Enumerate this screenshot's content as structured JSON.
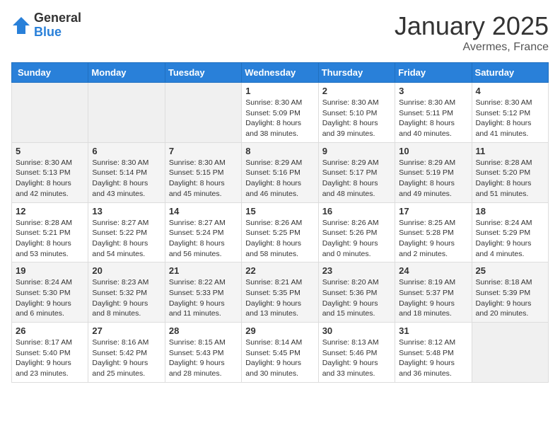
{
  "header": {
    "logo_general": "General",
    "logo_blue": "Blue",
    "month_title": "January 2025",
    "location": "Avermes, France"
  },
  "weekdays": [
    "Sunday",
    "Monday",
    "Tuesday",
    "Wednesday",
    "Thursday",
    "Friday",
    "Saturday"
  ],
  "weeks": [
    [
      {
        "day": "",
        "info": ""
      },
      {
        "day": "",
        "info": ""
      },
      {
        "day": "",
        "info": ""
      },
      {
        "day": "1",
        "info": "Sunrise: 8:30 AM\nSunset: 5:09 PM\nDaylight: 8 hours\nand 38 minutes."
      },
      {
        "day": "2",
        "info": "Sunrise: 8:30 AM\nSunset: 5:10 PM\nDaylight: 8 hours\nand 39 minutes."
      },
      {
        "day": "3",
        "info": "Sunrise: 8:30 AM\nSunset: 5:11 PM\nDaylight: 8 hours\nand 40 minutes."
      },
      {
        "day": "4",
        "info": "Sunrise: 8:30 AM\nSunset: 5:12 PM\nDaylight: 8 hours\nand 41 minutes."
      }
    ],
    [
      {
        "day": "5",
        "info": "Sunrise: 8:30 AM\nSunset: 5:13 PM\nDaylight: 8 hours\nand 42 minutes."
      },
      {
        "day": "6",
        "info": "Sunrise: 8:30 AM\nSunset: 5:14 PM\nDaylight: 8 hours\nand 43 minutes."
      },
      {
        "day": "7",
        "info": "Sunrise: 8:30 AM\nSunset: 5:15 PM\nDaylight: 8 hours\nand 45 minutes."
      },
      {
        "day": "8",
        "info": "Sunrise: 8:29 AM\nSunset: 5:16 PM\nDaylight: 8 hours\nand 46 minutes."
      },
      {
        "day": "9",
        "info": "Sunrise: 8:29 AM\nSunset: 5:17 PM\nDaylight: 8 hours\nand 48 minutes."
      },
      {
        "day": "10",
        "info": "Sunrise: 8:29 AM\nSunset: 5:19 PM\nDaylight: 8 hours\nand 49 minutes."
      },
      {
        "day": "11",
        "info": "Sunrise: 8:28 AM\nSunset: 5:20 PM\nDaylight: 8 hours\nand 51 minutes."
      }
    ],
    [
      {
        "day": "12",
        "info": "Sunrise: 8:28 AM\nSunset: 5:21 PM\nDaylight: 8 hours\nand 53 minutes."
      },
      {
        "day": "13",
        "info": "Sunrise: 8:27 AM\nSunset: 5:22 PM\nDaylight: 8 hours\nand 54 minutes."
      },
      {
        "day": "14",
        "info": "Sunrise: 8:27 AM\nSunset: 5:24 PM\nDaylight: 8 hours\nand 56 minutes."
      },
      {
        "day": "15",
        "info": "Sunrise: 8:26 AM\nSunset: 5:25 PM\nDaylight: 8 hours\nand 58 minutes."
      },
      {
        "day": "16",
        "info": "Sunrise: 8:26 AM\nSunset: 5:26 PM\nDaylight: 9 hours\nand 0 minutes."
      },
      {
        "day": "17",
        "info": "Sunrise: 8:25 AM\nSunset: 5:28 PM\nDaylight: 9 hours\nand 2 minutes."
      },
      {
        "day": "18",
        "info": "Sunrise: 8:24 AM\nSunset: 5:29 PM\nDaylight: 9 hours\nand 4 minutes."
      }
    ],
    [
      {
        "day": "19",
        "info": "Sunrise: 8:24 AM\nSunset: 5:30 PM\nDaylight: 9 hours\nand 6 minutes."
      },
      {
        "day": "20",
        "info": "Sunrise: 8:23 AM\nSunset: 5:32 PM\nDaylight: 9 hours\nand 8 minutes."
      },
      {
        "day": "21",
        "info": "Sunrise: 8:22 AM\nSunset: 5:33 PM\nDaylight: 9 hours\nand 11 minutes."
      },
      {
        "day": "22",
        "info": "Sunrise: 8:21 AM\nSunset: 5:35 PM\nDaylight: 9 hours\nand 13 minutes."
      },
      {
        "day": "23",
        "info": "Sunrise: 8:20 AM\nSunset: 5:36 PM\nDaylight: 9 hours\nand 15 minutes."
      },
      {
        "day": "24",
        "info": "Sunrise: 8:19 AM\nSunset: 5:37 PM\nDaylight: 9 hours\nand 18 minutes."
      },
      {
        "day": "25",
        "info": "Sunrise: 8:18 AM\nSunset: 5:39 PM\nDaylight: 9 hours\nand 20 minutes."
      }
    ],
    [
      {
        "day": "26",
        "info": "Sunrise: 8:17 AM\nSunset: 5:40 PM\nDaylight: 9 hours\nand 23 minutes."
      },
      {
        "day": "27",
        "info": "Sunrise: 8:16 AM\nSunset: 5:42 PM\nDaylight: 9 hours\nand 25 minutes."
      },
      {
        "day": "28",
        "info": "Sunrise: 8:15 AM\nSunset: 5:43 PM\nDaylight: 9 hours\nand 28 minutes."
      },
      {
        "day": "29",
        "info": "Sunrise: 8:14 AM\nSunset: 5:45 PM\nDaylight: 9 hours\nand 30 minutes."
      },
      {
        "day": "30",
        "info": "Sunrise: 8:13 AM\nSunset: 5:46 PM\nDaylight: 9 hours\nand 33 minutes."
      },
      {
        "day": "31",
        "info": "Sunrise: 8:12 AM\nSunset: 5:48 PM\nDaylight: 9 hours\nand 36 minutes."
      },
      {
        "day": "",
        "info": ""
      }
    ]
  ]
}
